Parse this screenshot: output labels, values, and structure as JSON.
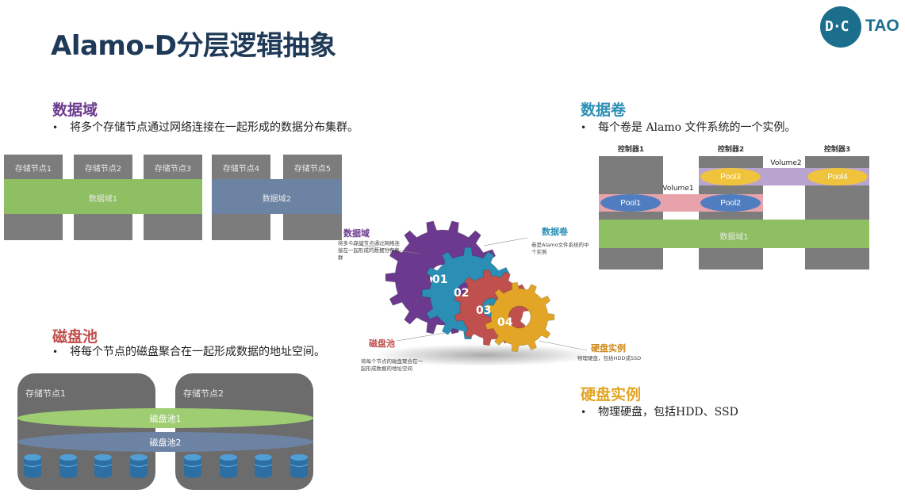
{
  "slide": {
    "title": "Alamo-D分层逻辑抽象"
  },
  "logo": {
    "mark": "D·C",
    "text": "TAO"
  },
  "colors": {
    "title": "#1f3a58",
    "purple": "#6b3a8e",
    "teal": "#2b8fb5",
    "red": "#c0504d",
    "gold": "#e2a525",
    "green": "#8fbf63",
    "blue_gray": "#6d83a3"
  },
  "data_domain": {
    "title": "数据域",
    "bullet": "将多个存储节点通过网络连接在一起形成的数据分布集群。",
    "nodes": [
      "存储节点1",
      "存储节点2",
      "存储节点3",
      "存储节点4",
      "存储节点5"
    ],
    "domain1": "数据域1",
    "domain2": "数据域2"
  },
  "data_volume": {
    "title": "数据卷",
    "bullet": "每个卷是 Alamo 文件系统的一个实例。",
    "controllers": [
      "控制器1",
      "控制器2",
      "控制器3"
    ],
    "volume1": "Volume1",
    "volume2": "Volume2",
    "pools": [
      "Pool1",
      "Pool2",
      "Pool3",
      "Pool4"
    ],
    "domain": "数据域1"
  },
  "disk_pool": {
    "title": "磁盘池",
    "bullet": "将每个节点的磁盘聚合在一起形成数据的地址空间。",
    "nodes": [
      "存储节点1",
      "存储节点2"
    ],
    "pool1": "磁盘池1",
    "pool2": "磁盘池2"
  },
  "disk_instance": {
    "title": "硬盘实例",
    "bullet": "物理硬盘，包括HDD、SSD"
  },
  "gears": {
    "numbers": [
      "01",
      "02",
      "03",
      "04"
    ],
    "label_domain": "数据域",
    "desc_domain": [
      "将多个存储节点通过网络连",
      "接在一起形成的数据分布集",
      "群"
    ],
    "label_volume": "数据卷",
    "desc_volume": [
      "卷是Alamo文件系统的中",
      "个实例"
    ],
    "label_pool": "磁盘池",
    "desc_pool": [
      "将每个节点的磁盘聚合在一",
      "起形成数据的地址空间"
    ],
    "label_disk": "硬盘实例",
    "desc_disk": [
      "物理硬盘，包括HDD或SSD"
    ]
  }
}
